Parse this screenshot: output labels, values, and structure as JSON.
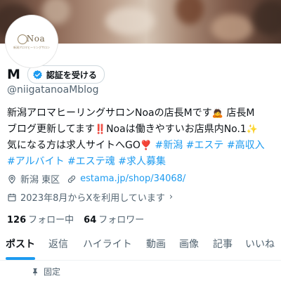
{
  "avatar": {
    "logo_text": "Noa",
    "logo_subtext": "新潟アロマヒーリングサロン"
  },
  "profile": {
    "name": "M",
    "verify_label": "認証を受ける",
    "handle": "@niigatanoaMblog"
  },
  "bio": {
    "line1": {
      "text": "新潟アロマヒーリングサロンNoaの店長Mです",
      "emoji": "🙇",
      "tail": " 店長M"
    },
    "line2": {
      "text": "ブログ更新してます",
      "emoji1": "‼️",
      "text2": "Noaは働きやすいお店県内No.1",
      "emoji2": "✨"
    },
    "line3": {
      "text": "気になる方は求人サイトへGO",
      "emoji": "❣️",
      "hashtags": [
        "#新潟",
        "#エステ",
        "#高収入"
      ]
    },
    "line4": {
      "hashtags": [
        "#アルバイト",
        "#エステ魂",
        "#求人募集"
      ]
    }
  },
  "meta": {
    "location": "新潟 東区",
    "website": "estama.jp/shop/34068/",
    "joined": "2023年8月からXを利用しています",
    "joined_chevron": "›"
  },
  "follow": {
    "following_count": "126",
    "following_label": "フォロー中",
    "followers_count": "64",
    "followers_label": "フォロワー"
  },
  "tabs": [
    "ポスト",
    "返信",
    "ハイライト",
    "動画",
    "画像",
    "記事",
    "いいね"
  ],
  "active_tab": "ポスト",
  "pinned_label": "固定",
  "colors": {
    "accent": "#1d9bf0",
    "text": "#0f1419",
    "secondary": "#536471"
  },
  "icons": [
    "verified-badge-icon",
    "location-pin-icon",
    "link-icon",
    "calendar-icon",
    "pin-icon"
  ]
}
